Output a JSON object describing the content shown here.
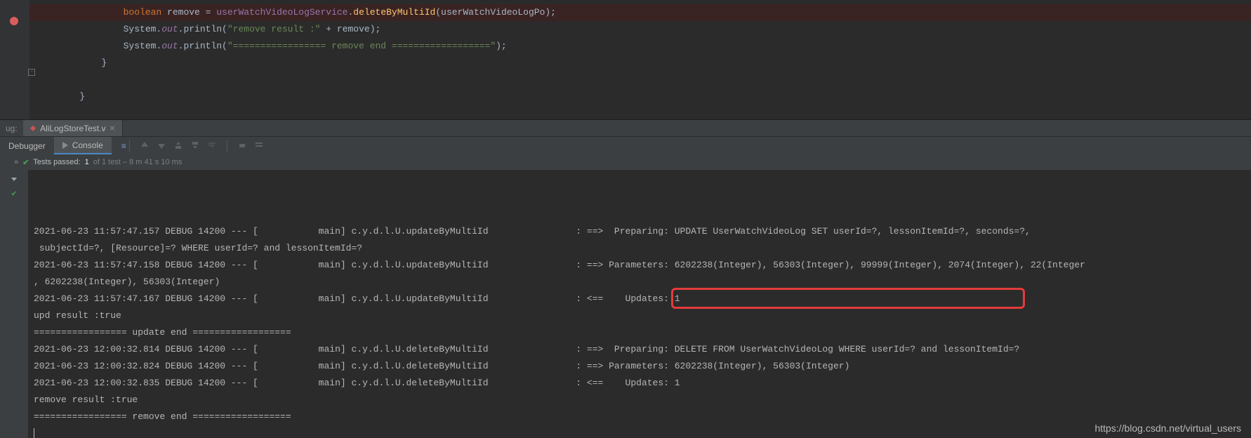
{
  "editor": {
    "lines": [
      {
        "bp": true,
        "indent": 3,
        "tokens": [
          {
            "cls": "tok-kw",
            "t": "boolean"
          },
          {
            "cls": "tok-def",
            "t": " remove = "
          },
          {
            "cls": "tok-fld",
            "t": "userWatchVideoLogService"
          },
          {
            "cls": "tok-def",
            "t": "."
          },
          {
            "cls": "tok-mtd",
            "t": "deleteByMultiId"
          },
          {
            "cls": "tok-def",
            "t": "("
          },
          {
            "cls": "tok-par",
            "t": "userWatchVideoLogPo"
          },
          {
            "cls": "tok-def",
            "t": ");"
          }
        ]
      },
      {
        "bp": false,
        "indent": 3,
        "tokens": [
          {
            "cls": "tok-def",
            "t": "System."
          },
          {
            "cls": "tok-stat",
            "t": "out"
          },
          {
            "cls": "tok-def",
            "t": ".println("
          },
          {
            "cls": "tok-str",
            "t": "\"remove result :\""
          },
          {
            "cls": "tok-def",
            "t": " + remove);"
          }
        ]
      },
      {
        "bp": false,
        "indent": 3,
        "tokens": [
          {
            "cls": "tok-def",
            "t": "System."
          },
          {
            "cls": "tok-stat",
            "t": "out"
          },
          {
            "cls": "tok-def",
            "t": ".println("
          },
          {
            "cls": "tok-str",
            "t": "\"================= remove end ==================\""
          },
          {
            "cls": "tok-def",
            "t": ");"
          }
        ]
      },
      {
        "bp": false,
        "indent": 2,
        "tokens": [
          {
            "cls": "tok-def",
            "t": "}"
          }
        ]
      },
      {
        "bp": false,
        "indent": 0,
        "tokens": []
      },
      {
        "bp": false,
        "indent": 1,
        "tokens": [
          {
            "cls": "tok-def",
            "t": "}"
          }
        ]
      }
    ]
  },
  "toolwindow": {
    "label": "ug:",
    "tab_name": "AliLogStoreTest.v"
  },
  "debugger": {
    "tabs": {
      "debugger": "Debugger",
      "console": "Console"
    }
  },
  "tests": {
    "prefix": "Tests passed:",
    "count": "1",
    "suffix": "of 1 test – 8 m 41 s 10 ms"
  },
  "console": {
    "lines": [
      "2021-06-23 11:57:47.157 DEBUG 14200 --- [           main] c.y.d.l.U.updateByMultiId                : ==>  Preparing: UPDATE UserWatchVideoLog SET userId=?, lessonItemId=?, seconds=?,",
      " subjectId=?, [Resource]=? WHERE userId=? and lessonItemId=?",
      "2021-06-23 11:57:47.158 DEBUG 14200 --- [           main] c.y.d.l.U.updateByMultiId                : ==> Parameters: 6202238(Integer), 56303(Integer), 99999(Integer), 2074(Integer), 22(Integer",
      ", 6202238(Integer), 56303(Integer)",
      "2021-06-23 11:57:47.167 DEBUG 14200 --- [           main] c.y.d.l.U.updateByMultiId                : <==    Updates: 1",
      "upd result :true",
      "================= update end ==================",
      "2021-06-23 12:00:32.814 DEBUG 14200 --- [           main] c.y.d.l.U.deleteByMultiId                : ==>  Preparing: DELETE FROM UserWatchVideoLog WHERE userId=? and lessonItemId=?",
      "2021-06-23 12:00:32.824 DEBUG 14200 --- [           main] c.y.d.l.U.deleteByMultiId                : ==> Parameters: 6202238(Integer), 56303(Integer)",
      "2021-06-23 12:00:32.835 DEBUG 14200 --- [           main] c.y.d.l.U.deleteByMultiId                : <==    Updates: 1",
      "remove result :true",
      "================= remove end =================="
    ],
    "highlight_line_index": 7
  },
  "watermark": "https://blog.csdn.net/virtual_users"
}
